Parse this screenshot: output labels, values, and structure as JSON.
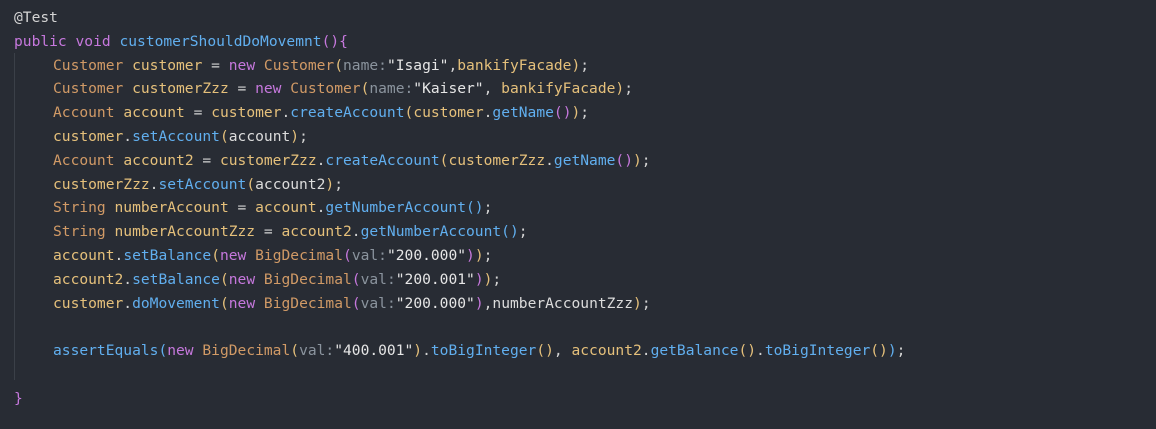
{
  "code_lines": [
    [
      {
        "t": "@Test",
        "k": "ann"
      }
    ],
    [
      {
        "t": "public",
        "k": "kw"
      },
      {
        "t": " ",
        "k": "plain"
      },
      {
        "t": "void",
        "k": "kw"
      },
      {
        "t": " ",
        "k": "plain"
      },
      {
        "t": "customerShouldDoMovemnt",
        "k": "fn"
      },
      {
        "t": "()",
        "k": "p2"
      },
      {
        "t": "{",
        "k": "p2"
      }
    ],
    [
      {
        "t": "Customer",
        "k": "type"
      },
      {
        "t": " ",
        "k": "plain"
      },
      {
        "t": "customer",
        "k": "var"
      },
      {
        "t": " = ",
        "k": "op"
      },
      {
        "t": "new",
        "k": "kw"
      },
      {
        "t": " ",
        "k": "plain"
      },
      {
        "t": "Customer",
        "k": "type"
      },
      {
        "t": "(",
        "k": "p1"
      },
      {
        "t": "name:",
        "k": "hint"
      },
      {
        "t": "\"Isagi\"",
        "k": "str"
      },
      {
        "t": ",",
        "k": "op"
      },
      {
        "t": "bankifyFacade",
        "k": "var"
      },
      {
        "t": ")",
        "k": "p1"
      },
      {
        "t": ";",
        "k": "op"
      }
    ],
    [
      {
        "t": "Customer",
        "k": "type"
      },
      {
        "t": " ",
        "k": "plain"
      },
      {
        "t": "customerZzz",
        "k": "var"
      },
      {
        "t": " = ",
        "k": "op"
      },
      {
        "t": "new",
        "k": "kw"
      },
      {
        "t": " ",
        "k": "plain"
      },
      {
        "t": "Customer",
        "k": "type"
      },
      {
        "t": "(",
        "k": "p1"
      },
      {
        "t": "name:",
        "k": "hint"
      },
      {
        "t": "\"Kaiser\"",
        "k": "str"
      },
      {
        "t": ", ",
        "k": "op"
      },
      {
        "t": "bankifyFacade",
        "k": "var"
      },
      {
        "t": ")",
        "k": "p1"
      },
      {
        "t": ";",
        "k": "op"
      }
    ],
    [
      {
        "t": "Account",
        "k": "type"
      },
      {
        "t": " ",
        "k": "plain"
      },
      {
        "t": "account",
        "k": "var"
      },
      {
        "t": " = ",
        "k": "op"
      },
      {
        "t": "customer",
        "k": "var"
      },
      {
        "t": ".",
        "k": "op"
      },
      {
        "t": "createAccount",
        "k": "fn"
      },
      {
        "t": "(",
        "k": "p1"
      },
      {
        "t": "customer",
        "k": "var"
      },
      {
        "t": ".",
        "k": "op"
      },
      {
        "t": "getName",
        "k": "fn"
      },
      {
        "t": "()",
        "k": "p2"
      },
      {
        "t": ")",
        "k": "p1"
      },
      {
        "t": ";",
        "k": "op"
      }
    ],
    [
      {
        "t": "customer",
        "k": "var"
      },
      {
        "t": ".",
        "k": "op"
      },
      {
        "t": "setAccount",
        "k": "fn"
      },
      {
        "t": "(",
        "k": "p1"
      },
      {
        "t": "account",
        "k": "plain"
      },
      {
        "t": ")",
        "k": "p1"
      },
      {
        "t": ";",
        "k": "op"
      }
    ],
    [
      {
        "t": "Account",
        "k": "type"
      },
      {
        "t": " ",
        "k": "plain"
      },
      {
        "t": "account2",
        "k": "var"
      },
      {
        "t": " = ",
        "k": "op"
      },
      {
        "t": "customerZzz",
        "k": "var"
      },
      {
        "t": ".",
        "k": "op"
      },
      {
        "t": "createAccount",
        "k": "fn"
      },
      {
        "t": "(",
        "k": "p1"
      },
      {
        "t": "customerZzz",
        "k": "var"
      },
      {
        "t": ".",
        "k": "op"
      },
      {
        "t": "getName",
        "k": "fn"
      },
      {
        "t": "()",
        "k": "p2"
      },
      {
        "t": ")",
        "k": "p1"
      },
      {
        "t": ";",
        "k": "op"
      }
    ],
    [
      {
        "t": "customerZzz",
        "k": "var"
      },
      {
        "t": ".",
        "k": "op"
      },
      {
        "t": "setAccount",
        "k": "fn"
      },
      {
        "t": "(",
        "k": "p1"
      },
      {
        "t": "account2",
        "k": "plain"
      },
      {
        "t": ")",
        "k": "p1"
      },
      {
        "t": ";",
        "k": "op"
      }
    ],
    [
      {
        "t": "String",
        "k": "type"
      },
      {
        "t": " ",
        "k": "plain"
      },
      {
        "t": "numberAccount",
        "k": "var"
      },
      {
        "t": " = ",
        "k": "op"
      },
      {
        "t": "account",
        "k": "var"
      },
      {
        "t": ".",
        "k": "op"
      },
      {
        "t": "getNumberAccount",
        "k": "fn"
      },
      {
        "t": "()",
        "k": "p3"
      },
      {
        "t": ";",
        "k": "op"
      }
    ],
    [
      {
        "t": "String",
        "k": "type"
      },
      {
        "t": " ",
        "k": "plain"
      },
      {
        "t": "numberAccountZzz",
        "k": "var"
      },
      {
        "t": " = ",
        "k": "op"
      },
      {
        "t": "account2",
        "k": "var"
      },
      {
        "t": ".",
        "k": "op"
      },
      {
        "t": "getNumberAccount",
        "k": "fn"
      },
      {
        "t": "()",
        "k": "p3"
      },
      {
        "t": ";",
        "k": "op"
      }
    ],
    [
      {
        "t": "account",
        "k": "var"
      },
      {
        "t": ".",
        "k": "op"
      },
      {
        "t": "setBalance",
        "k": "fn"
      },
      {
        "t": "(",
        "k": "p1"
      },
      {
        "t": "new",
        "k": "kw"
      },
      {
        "t": " ",
        "k": "plain"
      },
      {
        "t": "BigDecimal",
        "k": "type"
      },
      {
        "t": "(",
        "k": "p2"
      },
      {
        "t": "val:",
        "k": "hint"
      },
      {
        "t": "\"200.000\"",
        "k": "str"
      },
      {
        "t": ")",
        "k": "p2"
      },
      {
        "t": ")",
        "k": "p1"
      },
      {
        "t": ";",
        "k": "op"
      }
    ],
    [
      {
        "t": "account2",
        "k": "var"
      },
      {
        "t": ".",
        "k": "op"
      },
      {
        "t": "setBalance",
        "k": "fn"
      },
      {
        "t": "(",
        "k": "p1"
      },
      {
        "t": "new",
        "k": "kw"
      },
      {
        "t": " ",
        "k": "plain"
      },
      {
        "t": "BigDecimal",
        "k": "type"
      },
      {
        "t": "(",
        "k": "p2"
      },
      {
        "t": "val:",
        "k": "hint"
      },
      {
        "t": "\"200.001\"",
        "k": "str"
      },
      {
        "t": ")",
        "k": "p2"
      },
      {
        "t": ")",
        "k": "p1"
      },
      {
        "t": ";",
        "k": "op"
      }
    ],
    [
      {
        "t": "customer",
        "k": "var"
      },
      {
        "t": ".",
        "k": "op"
      },
      {
        "t": "doMovement",
        "k": "fn"
      },
      {
        "t": "(",
        "k": "p1"
      },
      {
        "t": "new",
        "k": "kw"
      },
      {
        "t": " ",
        "k": "plain"
      },
      {
        "t": "BigDecimal",
        "k": "type"
      },
      {
        "t": "(",
        "k": "p2"
      },
      {
        "t": "val:",
        "k": "hint"
      },
      {
        "t": "\"200.000\"",
        "k": "str"
      },
      {
        "t": ")",
        "k": "p2"
      },
      {
        "t": ",",
        "k": "op"
      },
      {
        "t": "numberAccountZzz",
        "k": "plain"
      },
      {
        "t": ")",
        "k": "p1"
      },
      {
        "t": ";",
        "k": "op"
      }
    ],
    [],
    [
      {
        "t": "assertEquals",
        "k": "fn"
      },
      {
        "t": "(",
        "k": "p3"
      },
      {
        "t": "new",
        "k": "kw"
      },
      {
        "t": " ",
        "k": "plain"
      },
      {
        "t": "BigDecimal",
        "k": "type"
      },
      {
        "t": "(",
        "k": "p1"
      },
      {
        "t": "val:",
        "k": "hint"
      },
      {
        "t": "\"400.001\"",
        "k": "str"
      },
      {
        "t": ")",
        "k": "p1"
      },
      {
        "t": ".",
        "k": "op"
      },
      {
        "t": "toBigInteger",
        "k": "fn"
      },
      {
        "t": "()",
        "k": "p1"
      },
      {
        "t": ", ",
        "k": "op"
      },
      {
        "t": "account2",
        "k": "var"
      },
      {
        "t": ".",
        "k": "op"
      },
      {
        "t": "getBalance",
        "k": "fn"
      },
      {
        "t": "()",
        "k": "p1"
      },
      {
        "t": ".",
        "k": "op"
      },
      {
        "t": "toBigInteger",
        "k": "fn"
      },
      {
        "t": "()",
        "k": "p1"
      },
      {
        "t": ")",
        "k": "p3"
      },
      {
        "t": ";",
        "k": "op"
      }
    ],
    [],
    [
      {
        "t": "}",
        "k": "p2"
      }
    ]
  ],
  "colors": {
    "background": "#282c34",
    "keyword": "#c678dd",
    "type": "#d19a66",
    "function": "#61afef",
    "variable": "#e5c07b",
    "string": "#e6e6e6",
    "param_hint": "#8b949e"
  }
}
